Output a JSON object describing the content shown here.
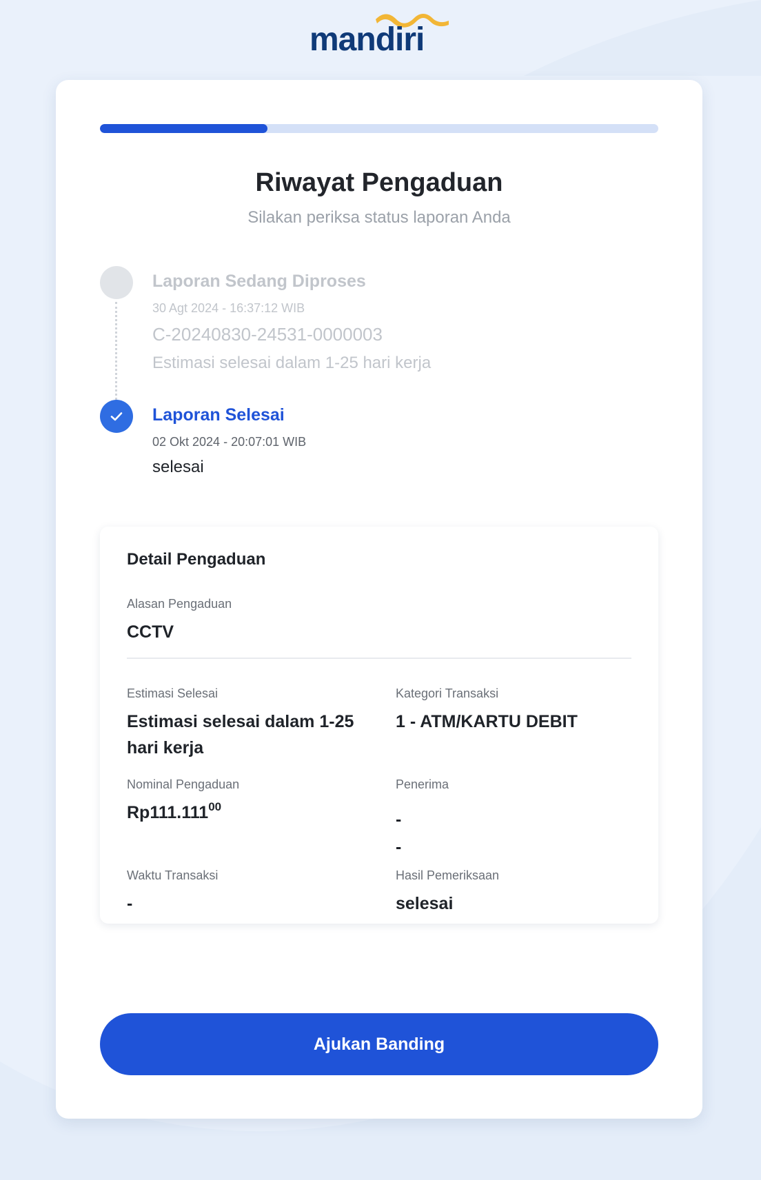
{
  "brand": {
    "name": "mandiri",
    "primary_color": "#1f53d8",
    "wave_color": "#f2b636"
  },
  "progress": {
    "fraction": 0.3
  },
  "header": {
    "title": "Riwayat Pengaduan",
    "subtitle": "Silakan periksa status laporan Anda"
  },
  "timeline": {
    "step1": {
      "title": "Laporan Sedang Diproses",
      "time": "30 Agt 2024 - 16:37:12 WIB",
      "code": "C-20240830-24531-0000003",
      "note": "Estimasi selesai dalam 1-25 hari kerja",
      "state": "inactive"
    },
    "step2": {
      "title": "Laporan Selesai",
      "time": "02 Okt 2024 - 20:07:01 WIB",
      "note": "selesai",
      "state": "active",
      "icon": "check-icon"
    }
  },
  "detail": {
    "title": "Detail Pengaduan",
    "reason_label": "Alasan Pengaduan",
    "reason_value": "CCTV",
    "estimate_label": "Estimasi Selesai",
    "estimate_value": "Estimasi selesai dalam 1-25 hari kerja",
    "category_label": "Kategori Transaksi",
    "category_value": "1 - ATM/KARTU DEBIT",
    "amount_label": "Nominal Pengaduan",
    "amount_main": "Rp111.111",
    "amount_decimal": "00",
    "recipient_label": "Penerima",
    "recipient_line1": "-",
    "recipient_line2": "-",
    "time_label": "Waktu Transaksi",
    "time_value": "-",
    "result_label": "Hasil Pemeriksaan",
    "result_value": "selesai"
  },
  "actions": {
    "appeal_label": "Ajukan Banding"
  }
}
